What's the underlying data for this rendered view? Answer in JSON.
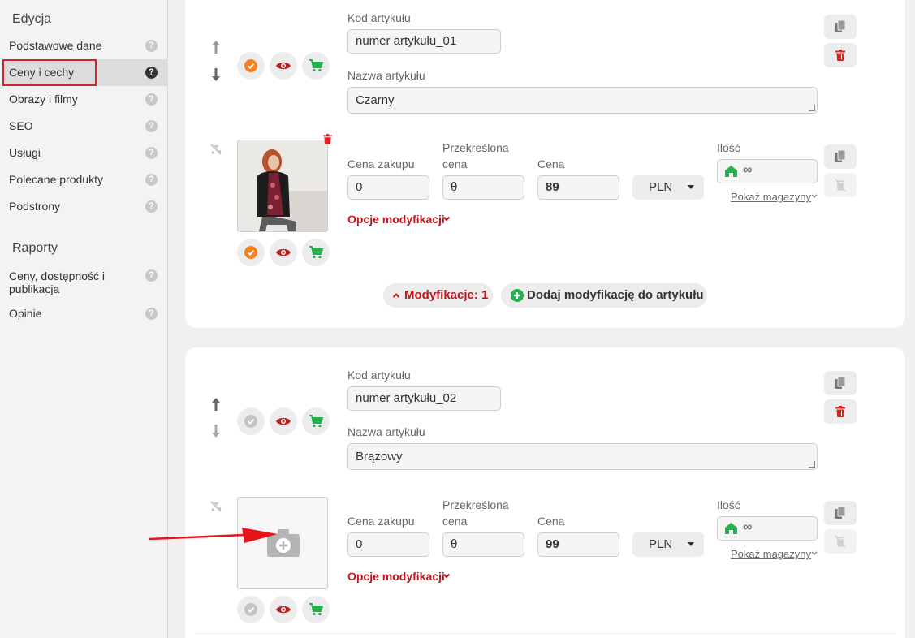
{
  "sidebar": {
    "heading_edit": "Edycja",
    "heading_reports": "Raporty",
    "items": [
      {
        "label": "Podstawowe dane"
      },
      {
        "label": "Ceny i cechy"
      },
      {
        "label": "Obrazy i filmy"
      },
      {
        "label": "SEO"
      },
      {
        "label": "Usługi"
      },
      {
        "label": "Polecane produkty"
      },
      {
        "label": "Podstrony"
      }
    ],
    "report_items": [
      {
        "label": "Ceny, dostępność i publikacja"
      },
      {
        "label": "Opinie"
      }
    ],
    "help_glyph": "?"
  },
  "labels": {
    "code": "Kod artykułu",
    "name": "Nazwa artykułu",
    "buy_price": "Cena zakupu",
    "crossed_price_1": "Przekreślona",
    "crossed_price_2": "cena",
    "price": "Cena",
    "quantity": "Ilość",
    "show_warehouse": "Pokaż magazyny",
    "modification_options": "Opcje modyfikacji",
    "infinity": "∞"
  },
  "articles": [
    {
      "code": "numer artykułu_01",
      "name": "Czarny",
      "buy_price": "0",
      "crossed_price": "θ",
      "price": "89",
      "currency": "PLN",
      "has_image": true
    },
    {
      "code": "numer artykułu_02",
      "name": "Brązowy",
      "buy_price": "0",
      "crossed_price": "θ",
      "price": "99",
      "currency": "PLN",
      "has_image": false
    }
  ],
  "modifications": {
    "toggle_label": "Modyfikacje: 1",
    "add_label": "Dodaj modyfikację do artykułu"
  },
  "colors": {
    "accent_red": "#c0151d",
    "check_orange": "#f58220",
    "cart_green": "#22b14c",
    "delete_red": "#e02020"
  }
}
